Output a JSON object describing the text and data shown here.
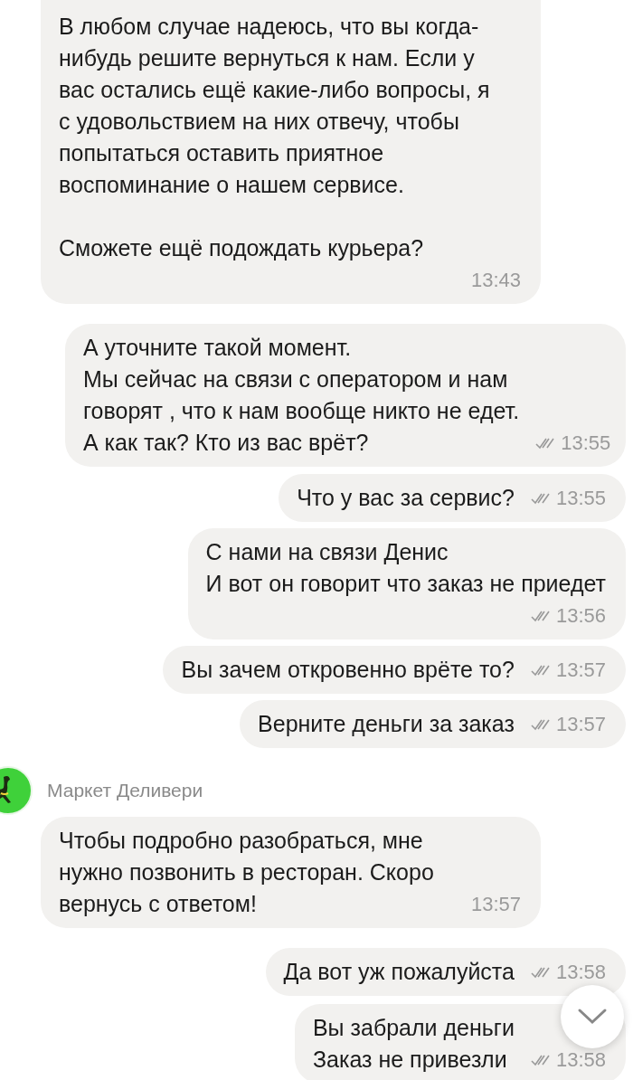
{
  "messages": [
    {
      "kind": "incoming",
      "paragraphs": [
        [
          "В любом случае надеюсь, что вы когда-",
          "нибудь решите вернуться к нам. Если у",
          "вас остались ещё какие-либо вопросы, я",
          "с удовольствием на них отвечу, чтобы",
          "попытаться оставить приятное",
          "воспоминание о нашем сервисе."
        ],
        [
          "Сможете ещё подождать курьера?"
        ]
      ],
      "time": "13:43",
      "time_below": true,
      "read": false
    },
    {
      "kind": "outgoing",
      "paragraphs": [
        [
          "А уточните такой момент.",
          "Мы сейчас на связи с оператором и нам",
          "говорят , что к нам вообще никто не едет.",
          "А как так? Кто из вас врёт?"
        ]
      ],
      "time": "13:55",
      "time_below": false,
      "read": true
    },
    {
      "kind": "outgoing",
      "paragraphs": [
        [
          "Что у вас за сервис?"
        ]
      ],
      "time": "13:55",
      "time_below": false,
      "read": true
    },
    {
      "kind": "outgoing",
      "paragraphs": [
        [
          "С нами на связи Денис",
          "И вот он говорит что заказ не приедет"
        ]
      ],
      "time": "13:56",
      "time_below": true,
      "read": true
    },
    {
      "kind": "outgoing",
      "paragraphs": [
        [
          "Вы зачем откровенно врёте то?"
        ]
      ],
      "time": "13:57",
      "time_below": false,
      "read": true
    },
    {
      "kind": "outgoing",
      "paragraphs": [
        [
          "Верните деньги за заказ"
        ]
      ],
      "time": "13:57",
      "time_below": false,
      "read": true
    },
    {
      "kind": "sender",
      "name": "Маркет Деливери"
    },
    {
      "kind": "incoming",
      "paragraphs": [
        [
          "Чтобы подробно разобраться, мне",
          "нужно позвонить в ресторан. Скоро",
          "вернусь с ответом!"
        ]
      ],
      "time": "13:57",
      "time_below": false,
      "read": false
    },
    {
      "kind": "outgoing",
      "paragraphs": [
        [
          "Да вот уж пожалуйста"
        ]
      ],
      "time": "13:58",
      "time_below": false,
      "read": true
    },
    {
      "kind": "outgoing",
      "paragraphs": [
        [
          "Вы забрали деньги",
          "Заказ не привезли"
        ]
      ],
      "time": "13:58",
      "time_below": false,
      "read": true
    }
  ]
}
